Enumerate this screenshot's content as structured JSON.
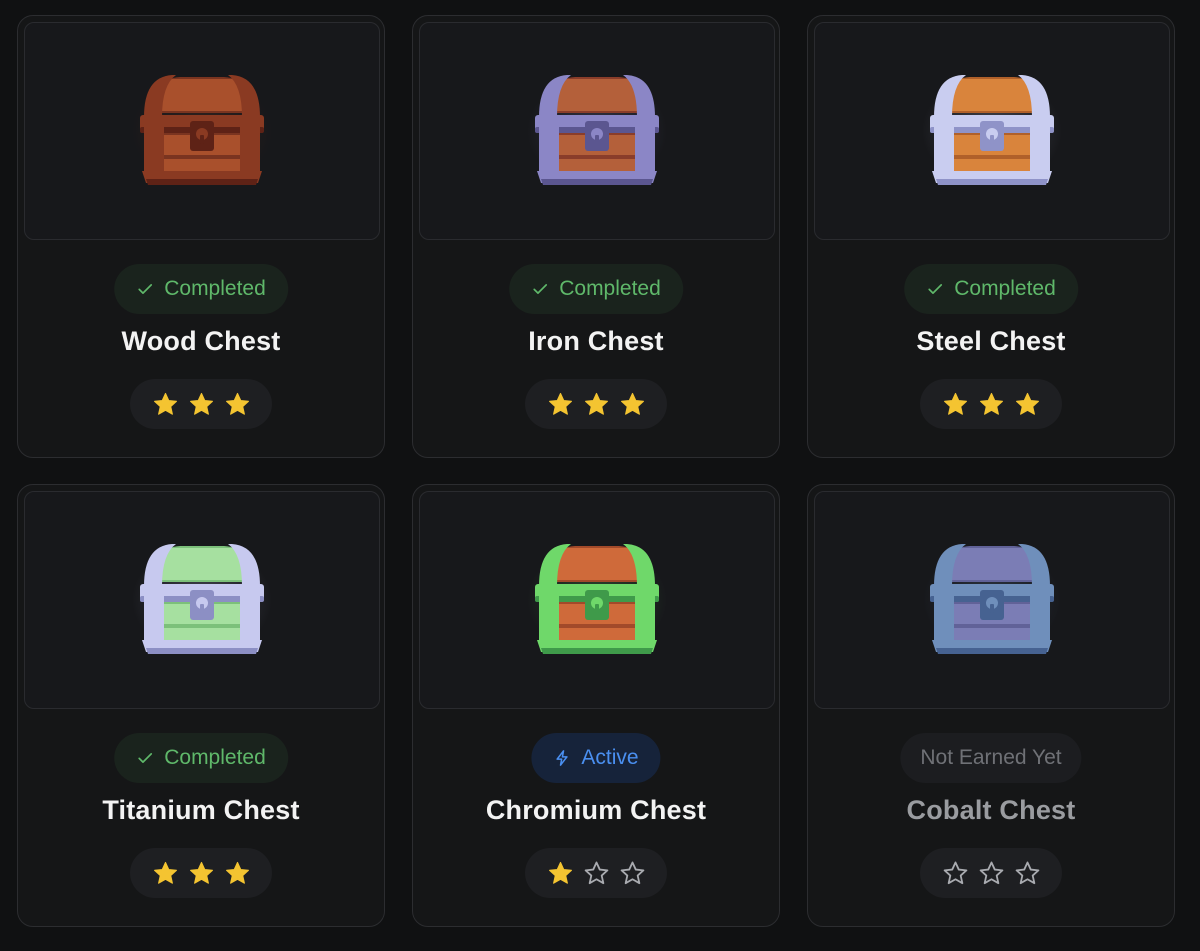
{
  "colors": {
    "page_bg": "#101112",
    "card_bg": "#151617",
    "completed": "#5fb86a",
    "active": "#4a8ff0",
    "locked_text": "#6f7176",
    "star_filled": "#f4c431",
    "star_empty": "#a9abb0"
  },
  "chests": [
    {
      "name": "Wood Chest",
      "status": "completed",
      "status_label": "Completed",
      "status_icon": "check-icon",
      "stars_earned": 3,
      "stars_total": 3,
      "palette": {
        "frame": "#8a3a22",
        "frame_dark": "#5e2216",
        "body": "#a9502c",
        "plank": "#7a3420"
      }
    },
    {
      "name": "Iron Chest",
      "status": "completed",
      "status_label": "Completed",
      "status_icon": "check-icon",
      "stars_earned": 3,
      "stars_total": 3,
      "palette": {
        "frame": "#8b86c6",
        "frame_dark": "#5b5690",
        "body": "#b4603a",
        "plank": "#8a3d2a"
      }
    },
    {
      "name": "Steel Chest",
      "status": "completed",
      "status_label": "Completed",
      "status_icon": "check-icon",
      "stars_earned": 3,
      "stars_total": 3,
      "palette": {
        "frame": "#c9cdf0",
        "frame_dark": "#8f93c8",
        "body": "#d9843c",
        "plank": "#b0602a"
      }
    },
    {
      "name": "Titanium Chest",
      "status": "completed",
      "status_label": "Completed",
      "status_icon": "check-icon",
      "stars_earned": 3,
      "stars_total": 3,
      "palette": {
        "frame": "#c7c9ef",
        "frame_dark": "#8c8fc4",
        "body": "#a6e0a0",
        "plank": "#7cc07a"
      }
    },
    {
      "name": "Chromium Chest",
      "status": "active",
      "status_label": "Active",
      "status_icon": "lightning-icon",
      "stars_earned": 1,
      "stars_total": 3,
      "palette": {
        "frame": "#6fd86a",
        "frame_dark": "#3f9a4a",
        "body": "#cf6a3a",
        "plank": "#a24a2a"
      }
    },
    {
      "name": "Cobalt Chest",
      "status": "locked",
      "status_label": "Not Earned Yet",
      "status_icon": "",
      "stars_earned": 0,
      "stars_total": 3,
      "palette": {
        "frame": "#7fa4d8",
        "frame_dark": "#4f6fa6",
        "body": "#8d8fd0",
        "plank": "#6e70ae"
      }
    }
  ]
}
